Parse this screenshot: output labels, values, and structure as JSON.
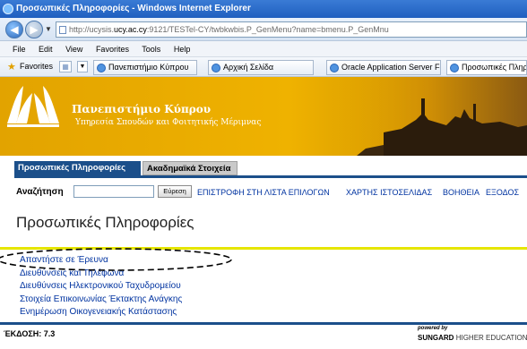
{
  "window": {
    "title": "Προσωπικές Πληροφορίες - Windows Internet Explorer"
  },
  "address": {
    "prefix": "http://ucysis.",
    "domain": "ucy.ac.cy",
    "suffix": ":9121/TESTel-CY/twbkwbis.P_GenMenu?name=bmenu.P_GenMnu"
  },
  "menu": {
    "items": [
      "File",
      "Edit",
      "View",
      "Favorites",
      "Tools",
      "Help"
    ]
  },
  "favorites": {
    "label": "Favorites",
    "tabs": [
      "Πανεπιστήμιο Κύπρου",
      "Αρχική Σελίδα",
      "Oracle Application Server Fo...",
      "Προσωπικές Πληροφ..."
    ]
  },
  "banner": {
    "name": "Πανεπιστήμιο Κύπρου",
    "subtitle": "Υπηρεσία Σπουδών και Φοιτητικής Μέριμνας"
  },
  "tabs": {
    "personal": "Προσωπικές Πληροφορίες",
    "academic": "Ακαδημαϊκά Στοιχεία"
  },
  "search": {
    "label": "Αναζήτηση",
    "value": "",
    "button": "Εύρεση"
  },
  "toplinks": {
    "back_to_list": "ΕΠΙΣΤΡΟΦΗ ΣΤΗ ΛΙΣΤΑ ΕΠΙΛΟΓΩΝ",
    "site_map": "ΧΑΡΤΗΣ ΙΣΤΟΣΕΛΙΔΑΣ",
    "help": "ΒΟΗΘΕΙΑ",
    "exit": "ΕΞΟΔΟΣ"
  },
  "page": {
    "title": "Προσωπικές Πληροφορίες"
  },
  "links": [
    "Απαντήστε σε Έρευνα",
    "Διευθύνσεις και Τηλέφωνα",
    "Διευθύνσεις Ηλεκτρονικού Ταχυδρομείου",
    "Στοιχεία Επικοινωνίας Έκτακτης Ανάγκης",
    "Ενημέρωση Οικογενειακής Κατάστασης"
  ],
  "footer": {
    "version": "ΈΚΔΟΣΗ: 7.3",
    "powered_by": "powered by",
    "vendor": "SUNGARD",
    "vendor_suffix": "HIGHER EDUCATION"
  },
  "colors": {
    "banner_gold": "#efb200",
    "tab_navy": "#1b4f8a",
    "link_blue": "#0033a0",
    "title_rule_yellow": "#e6e600"
  }
}
